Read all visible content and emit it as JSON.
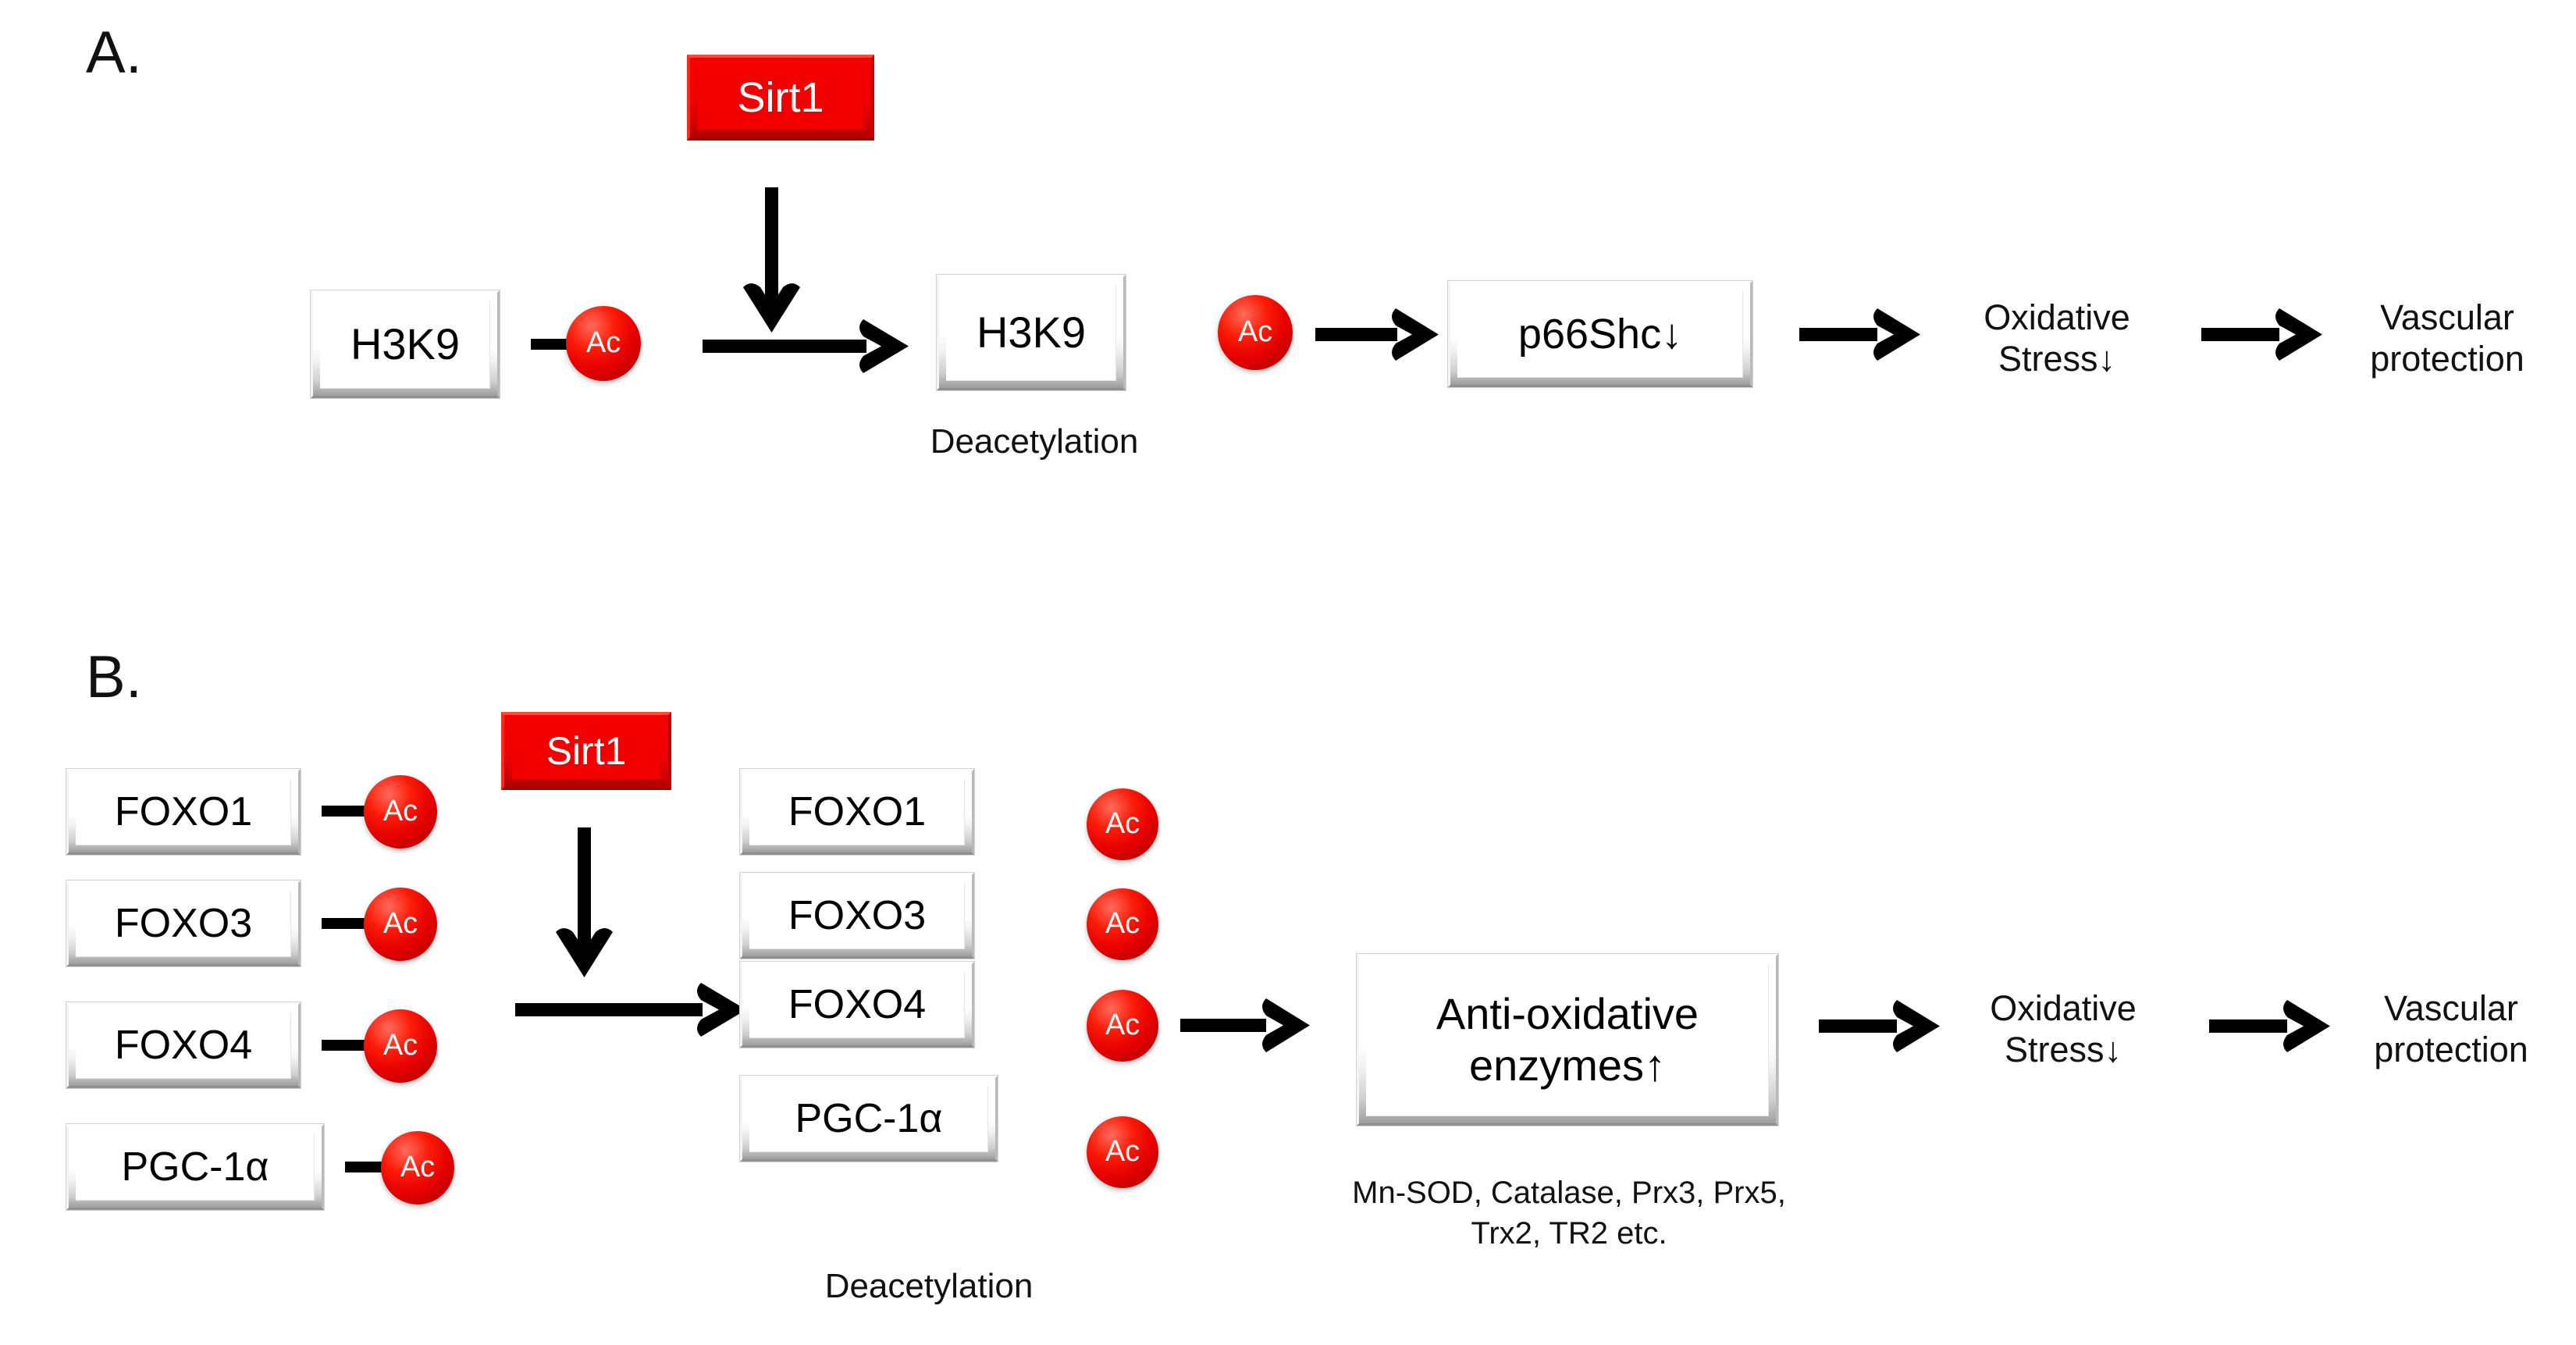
{
  "figure": {
    "type": "pathway-diagram",
    "background": "#ffffff",
    "accent_red": "#EE0000",
    "panels": [
      {
        "id": "A",
        "letter": "A.",
        "enzyme": {
          "label": "Sirt1",
          "color": "#EE0000"
        },
        "substrate_box": {
          "label": "H3K9"
        },
        "substrate_mark": {
          "label": "Ac"
        },
        "product_box": {
          "label": "H3K9"
        },
        "product_caption": "Deacetylation",
        "free_mark": {
          "label": "Ac"
        },
        "target_box": {
          "label": "p66Shc↓"
        },
        "outcome_1": "Oxidative\nStress↓",
        "outcome_2": "Vascular\nprotection"
      },
      {
        "id": "B",
        "letter": "B.",
        "enzyme": {
          "label": "Sirt1",
          "color": "#EE0000"
        },
        "substrates": [
          {
            "label": "FOXO1",
            "mark": "Ac"
          },
          {
            "label": "FOXO3",
            "mark": "Ac"
          },
          {
            "label": "FOXO4",
            "mark": "Ac"
          },
          {
            "label": "PGC-1α",
            "mark": "Ac"
          }
        ],
        "products": [
          {
            "label": "FOXO1"
          },
          {
            "label": "FOXO3"
          },
          {
            "label": "FOXO4"
          },
          {
            "label": "PGC-1α"
          }
        ],
        "released_marks": [
          "Ac",
          "Ac",
          "Ac",
          "Ac"
        ],
        "product_caption": "Deacetylation",
        "effect_box": {
          "label": "Anti-oxidative\nenzymes↑"
        },
        "effect_caption": "Mn-SOD, Catalase,\nPrx3, Prx5, Trx2, TR2 etc.",
        "outcome_1": "Oxidative\nStress↓",
        "outcome_2": "Vascular\nprotection"
      }
    ]
  }
}
